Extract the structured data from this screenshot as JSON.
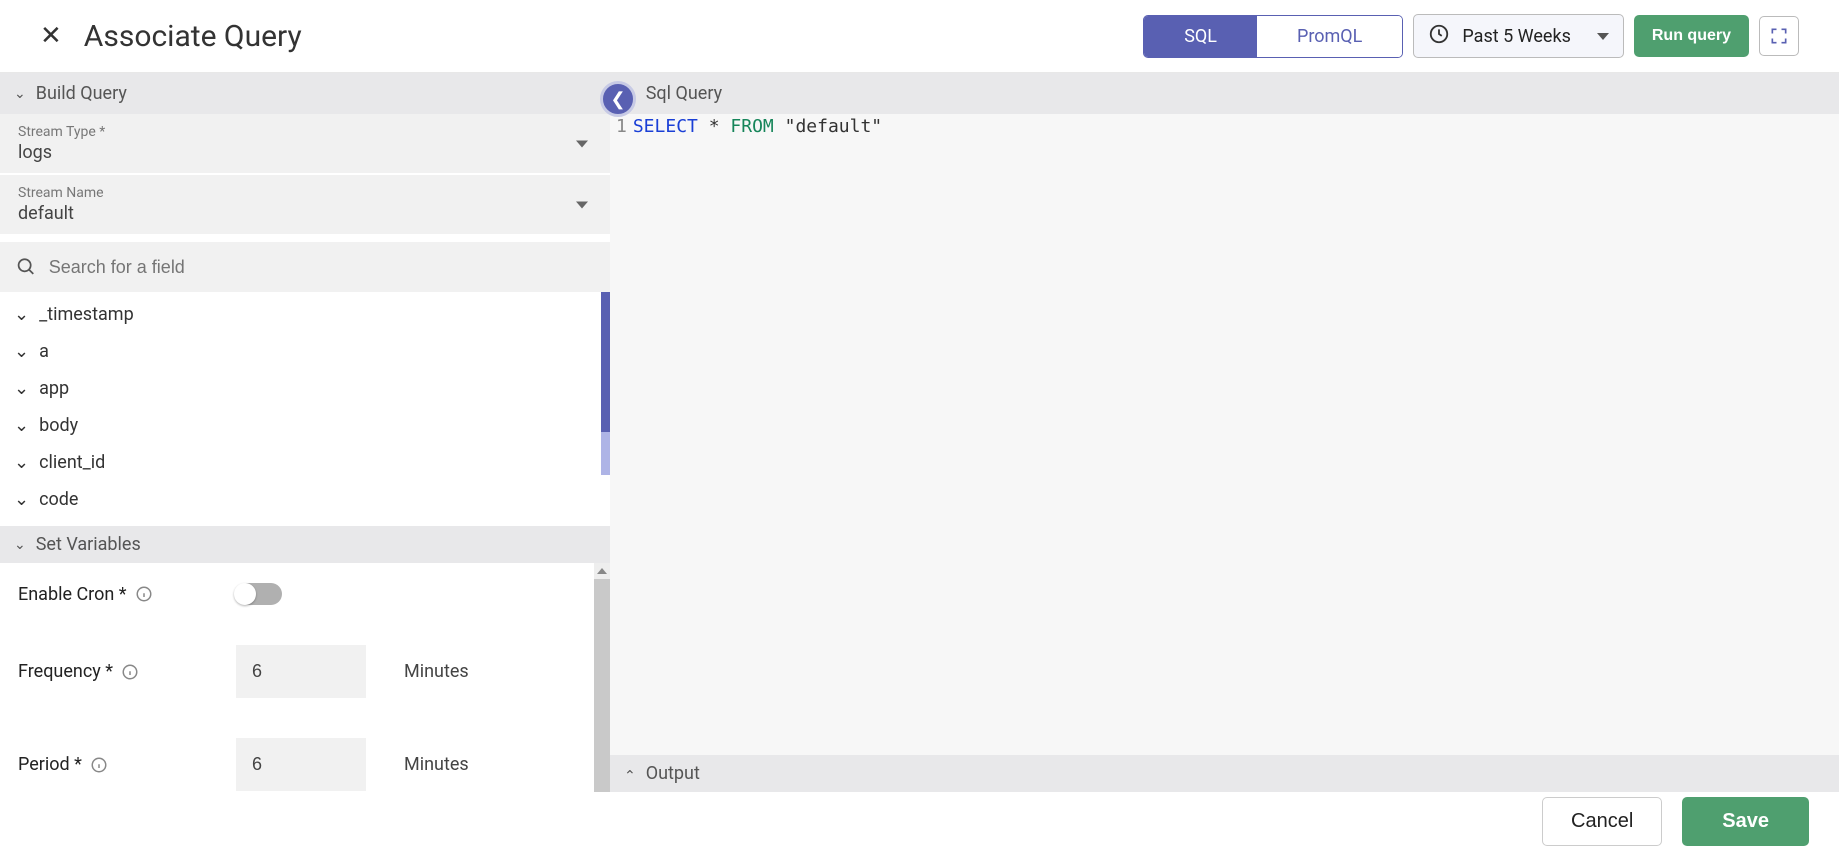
{
  "header": {
    "title": "Associate Query",
    "tabs": {
      "sql": "SQL",
      "promql": "PromQL"
    },
    "time_range": "Past 5 Weeks",
    "run_label": "Run query"
  },
  "build": {
    "section_title": "Build Query",
    "stream_type": {
      "label": "Stream Type *",
      "value": "logs"
    },
    "stream_name": {
      "label": "Stream Name",
      "value": "default"
    },
    "search_placeholder": "Search for a field",
    "fields": [
      "_timestamp",
      "a",
      "app",
      "body",
      "client_id",
      "code"
    ]
  },
  "vars": {
    "section_title": "Set Variables",
    "enable_cron_label": "Enable Cron *",
    "enable_cron_value": false,
    "frequency_label": "Frequency *",
    "frequency_value": "6",
    "frequency_unit": "Minutes",
    "period_label": "Period *",
    "period_value": "6",
    "period_unit": "Minutes"
  },
  "sql": {
    "section_title": "Sql Query",
    "line_no": "1",
    "kw_select": "SELECT",
    "star": "*",
    "kw_from": "FROM",
    "table": "\"default\""
  },
  "output": {
    "section_title": "Output"
  },
  "footer": {
    "cancel": "Cancel",
    "save": "Save"
  }
}
